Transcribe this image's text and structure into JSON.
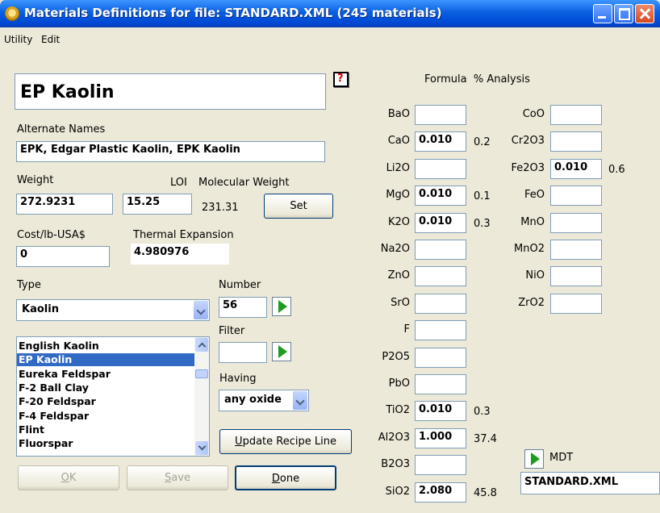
{
  "window": {
    "title": "Materials Definitions for file: STANDARD.XML (245 materials)"
  },
  "menu": [
    "Utility",
    "Edit"
  ],
  "material": {
    "name": "EP Kaolin",
    "help": "?"
  },
  "alternate_names": {
    "label": "Alternate Names",
    "value": "EPK, Edgar Plastic Kaolin, EPK Kaolin"
  },
  "weight": {
    "label": "Weight",
    "value": "272.9231"
  },
  "loi": {
    "label": "LOI",
    "value": "15.25"
  },
  "molecular_weight": {
    "label": "Molecular Weight",
    "value": "231.31"
  },
  "set_button": "Set",
  "cost": {
    "label": "Cost/lb-USA$",
    "value": "0"
  },
  "thermal_expansion": {
    "label": "Thermal Expansion",
    "value": "4.980976"
  },
  "type": {
    "label": "Type",
    "value": "Kaolin"
  },
  "number": {
    "label": "Number",
    "value": "56"
  },
  "filter": {
    "label": "Filter",
    "value": ""
  },
  "having": {
    "label": "Having",
    "value": "any oxide"
  },
  "materials_list": {
    "items": [
      "English Kaolin",
      "EP Kaolin",
      "Eureka Feldspar",
      "F-2 Ball Clay",
      "F-20 Feldspar",
      "F-4 Feldspar",
      "Flint",
      "Fluorspar"
    ],
    "selected_index": 1
  },
  "update_button": {
    "pre": "",
    "key": "U",
    "post": "pdate Recipe Line"
  },
  "ok_button": {
    "key": "O",
    "post": "K"
  },
  "save_button": {
    "key": "S",
    "post": "ave"
  },
  "done_button": {
    "key": "D",
    "post": "one"
  },
  "analysis_header": "Formula  % Analysis",
  "oxides_left": [
    {
      "name": "BaO",
      "value": "",
      "pct": ""
    },
    {
      "name": "CaO",
      "value": "0.010",
      "pct": "0.2"
    },
    {
      "name": "Li2O",
      "value": "",
      "pct": ""
    },
    {
      "name": "MgO",
      "value": "0.010",
      "pct": "0.1"
    },
    {
      "name": "K2O",
      "value": "0.010",
      "pct": "0.3"
    },
    {
      "name": "Na2O",
      "value": "",
      "pct": ""
    },
    {
      "name": "ZnO",
      "value": "",
      "pct": ""
    },
    {
      "name": "SrO",
      "value": "",
      "pct": ""
    },
    {
      "name": "F",
      "value": "",
      "pct": ""
    },
    {
      "name": "P2O5",
      "value": "",
      "pct": ""
    },
    {
      "name": "PbO",
      "value": "",
      "pct": ""
    },
    {
      "name": "TiO2",
      "value": "0.010",
      "pct": "0.3"
    },
    {
      "name": "Al2O3",
      "value": "1.000",
      "pct": "37.4"
    },
    {
      "name": "B2O3",
      "value": "",
      "pct": ""
    },
    {
      "name": "SiO2",
      "value": "2.080",
      "pct": "45.8"
    }
  ],
  "oxides_right": [
    {
      "name": "CoO",
      "value": "",
      "pct": ""
    },
    {
      "name": "Cr2O3",
      "value": "",
      "pct": ""
    },
    {
      "name": "Fe2O3",
      "value": "0.010",
      "pct": "0.6"
    },
    {
      "name": "FeO",
      "value": "",
      "pct": ""
    },
    {
      "name": "MnO",
      "value": "",
      "pct": ""
    },
    {
      "name": "MnO2",
      "value": "",
      "pct": ""
    },
    {
      "name": "NiO",
      "value": "",
      "pct": ""
    },
    {
      "name": "ZrO2",
      "value": "",
      "pct": ""
    }
  ],
  "mdt": {
    "label": "MDT",
    "file": "STANDARD.XML"
  }
}
